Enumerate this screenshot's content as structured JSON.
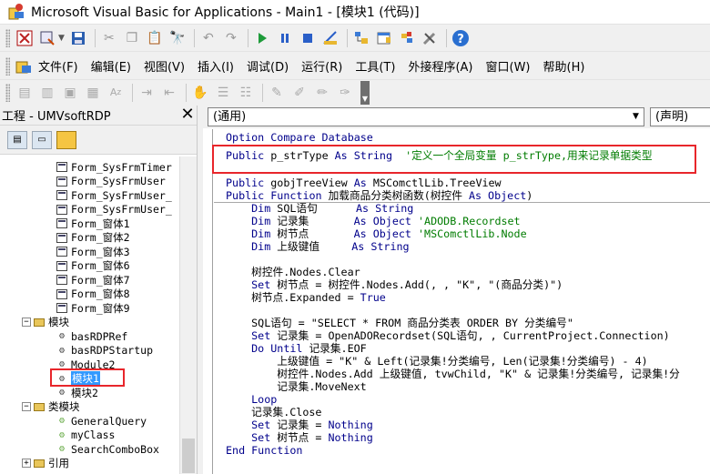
{
  "window": {
    "title": "Microsoft Visual Basic for Applications - Main1 - [模块1 (代码)]"
  },
  "toolbar_top": {
    "icons": [
      "vba-excel-icon",
      "insert-userform-icon",
      "save-icon",
      "cut-icon",
      "copy-icon",
      "paste-icon",
      "find-icon",
      "undo-icon",
      "redo-icon",
      "run-icon",
      "break-icon",
      "reset-icon",
      "design-mode-icon",
      "project-explorer-icon",
      "properties-icon",
      "object-browser-icon",
      "toolbox-icon",
      "help-icon"
    ]
  },
  "menu": {
    "items": [
      "文件(F)",
      "编辑(E)",
      "视图(V)",
      "插入(I)",
      "调试(D)",
      "运行(R)",
      "工具(T)",
      "外接程序(A)",
      "窗口(W)",
      "帮助(H)"
    ]
  },
  "project_pane": {
    "title": "工程 - UMVsoftRDP",
    "tree": [
      {
        "label": "Form_SysFrmTimer",
        "kind": "form"
      },
      {
        "label": "Form_SysFrmUser",
        "kind": "form"
      },
      {
        "label": "Form_SysFrmUser_",
        "kind": "form"
      },
      {
        "label": "Form_SysFrmUser_",
        "kind": "form"
      },
      {
        "label": "Form_窗体1",
        "kind": "form"
      },
      {
        "label": "Form_窗体2",
        "kind": "form"
      },
      {
        "label": "Form_窗体3",
        "kind": "form"
      },
      {
        "label": "Form_窗体6",
        "kind": "form"
      },
      {
        "label": "Form_窗体7",
        "kind": "form"
      },
      {
        "label": "Form_窗体8",
        "kind": "form"
      },
      {
        "label": "Form_窗体9",
        "kind": "form"
      },
      {
        "label": "模块",
        "kind": "folder"
      },
      {
        "label": "basRDPRef",
        "kind": "module"
      },
      {
        "label": "basRDPStartup",
        "kind": "module"
      },
      {
        "label": "Module2",
        "kind": "module"
      },
      {
        "label": "模块1",
        "kind": "module",
        "selected": true
      },
      {
        "label": "模块2",
        "kind": "module"
      },
      {
        "label": "类模块",
        "kind": "folder"
      },
      {
        "label": "GeneralQuery",
        "kind": "class"
      },
      {
        "label": "myClass",
        "kind": "class"
      },
      {
        "label": "SearchComboBox",
        "kind": "class"
      },
      {
        "label": "引用",
        "kind": "folder"
      }
    ]
  },
  "code_pane": {
    "object_combo": "(通用)",
    "proc_combo": "(声明)",
    "lines": [
      {
        "parts": [
          {
            "t": "Option Compare Database",
            "c": "kw"
          }
        ]
      },
      {
        "parts": [
          {
            "t": "Public",
            "c": "kw"
          },
          {
            "t": " p_strType ",
            "c": "txt"
          },
          {
            "t": "As",
            "c": "kw"
          },
          {
            "t": " ",
            "c": "txt"
          },
          {
            "t": "String",
            "c": "kw"
          },
          {
            "t": "  '定义一个全局变量 p_strType,用来记录单据类型",
            "c": "cm"
          }
        ]
      },
      {
        "parts": [
          {
            "t": "Public",
            "c": "kw"
          },
          {
            "t": " gobjTreeView ",
            "c": "txt"
          },
          {
            "t": "As",
            "c": "kw"
          },
          {
            "t": " MSComctlLib.TreeView",
            "c": "txt"
          }
        ]
      },
      {
        "parts": [
          {
            "t": "Public Function",
            "c": "kw"
          },
          {
            "t": " 加载商品分类树函数(树控件 ",
            "c": "txt"
          },
          {
            "t": "As Object",
            "c": "kw"
          },
          {
            "t": ")",
            "c": "txt"
          }
        ]
      },
      {
        "parts": [
          {
            "t": "    Dim",
            "c": "kw"
          },
          {
            "t": " SQL语句      ",
            "c": "txt"
          },
          {
            "t": "As String",
            "c": "kw"
          }
        ]
      },
      {
        "parts": [
          {
            "t": "    Dim",
            "c": "kw"
          },
          {
            "t": " 记录集       ",
            "c": "txt"
          },
          {
            "t": "As Object",
            "c": "kw"
          },
          {
            "t": " 'ADODB.Recordset",
            "c": "cm"
          }
        ]
      },
      {
        "parts": [
          {
            "t": "    Dim",
            "c": "kw"
          },
          {
            "t": " 树节点       ",
            "c": "txt"
          },
          {
            "t": "As Object",
            "c": "kw"
          },
          {
            "t": " 'MSComctlLib.Node",
            "c": "cm"
          }
        ]
      },
      {
        "parts": [
          {
            "t": "    Dim",
            "c": "kw"
          },
          {
            "t": " 上级键值     ",
            "c": "txt"
          },
          {
            "t": "As String",
            "c": "kw"
          }
        ]
      },
      {
        "parts": []
      },
      {
        "parts": [
          {
            "t": "    树控件.Nodes.Clear",
            "c": "txt"
          }
        ]
      },
      {
        "parts": [
          {
            "t": "    Set",
            "c": "kw"
          },
          {
            "t": " 树节点 = 树控件.Nodes.Add(, , \"K\", \"(商品分类)\")",
            "c": "txt"
          }
        ]
      },
      {
        "parts": [
          {
            "t": "    树节点.Expanded = ",
            "c": "txt"
          },
          {
            "t": "True",
            "c": "kw"
          }
        ]
      },
      {
        "parts": []
      },
      {
        "parts": [
          {
            "t": "    SQL语句 = \"SELECT * FROM 商品分类表 ORDER BY 分类编号\"",
            "c": "txt"
          }
        ]
      },
      {
        "parts": [
          {
            "t": "    Set",
            "c": "kw"
          },
          {
            "t": " 记录集 = OpenADORecordset(SQL语句, , CurrentProject.Connection)",
            "c": "txt"
          }
        ]
      },
      {
        "parts": [
          {
            "t": "    Do Until",
            "c": "kw"
          },
          {
            "t": " 记录集.EOF",
            "c": "txt"
          }
        ]
      },
      {
        "parts": [
          {
            "t": "        上级键值 = \"K\" & Left(记录集!分类编号, Len(记录集!分类编号) - 4)",
            "c": "txt"
          }
        ]
      },
      {
        "parts": [
          {
            "t": "        树控件.Nodes.Add 上级键值, tvwChild, \"K\" & 记录集!分类编号, 记录集!分",
            "c": "txt"
          }
        ]
      },
      {
        "parts": [
          {
            "t": "        记录集.MoveNext",
            "c": "txt"
          }
        ]
      },
      {
        "parts": [
          {
            "t": "    Loop",
            "c": "kw"
          }
        ]
      },
      {
        "parts": [
          {
            "t": "    记录集.Close",
            "c": "txt"
          }
        ]
      },
      {
        "parts": [
          {
            "t": "    Set",
            "c": "kw"
          },
          {
            "t": " 记录集 = ",
            "c": "txt"
          },
          {
            "t": "Nothing",
            "c": "kw"
          }
        ]
      },
      {
        "parts": [
          {
            "t": "    Set",
            "c": "kw"
          },
          {
            "t": " 树节点 = ",
            "c": "txt"
          },
          {
            "t": "Nothing",
            "c": "kw"
          }
        ]
      },
      {
        "parts": [
          {
            "t": "End Function",
            "c": "kw"
          }
        ]
      }
    ]
  },
  "colors": {
    "keyword": "#00008b",
    "comment": "#007c00",
    "highlight_box": "#e8262b",
    "selection": "#3399ff"
  }
}
